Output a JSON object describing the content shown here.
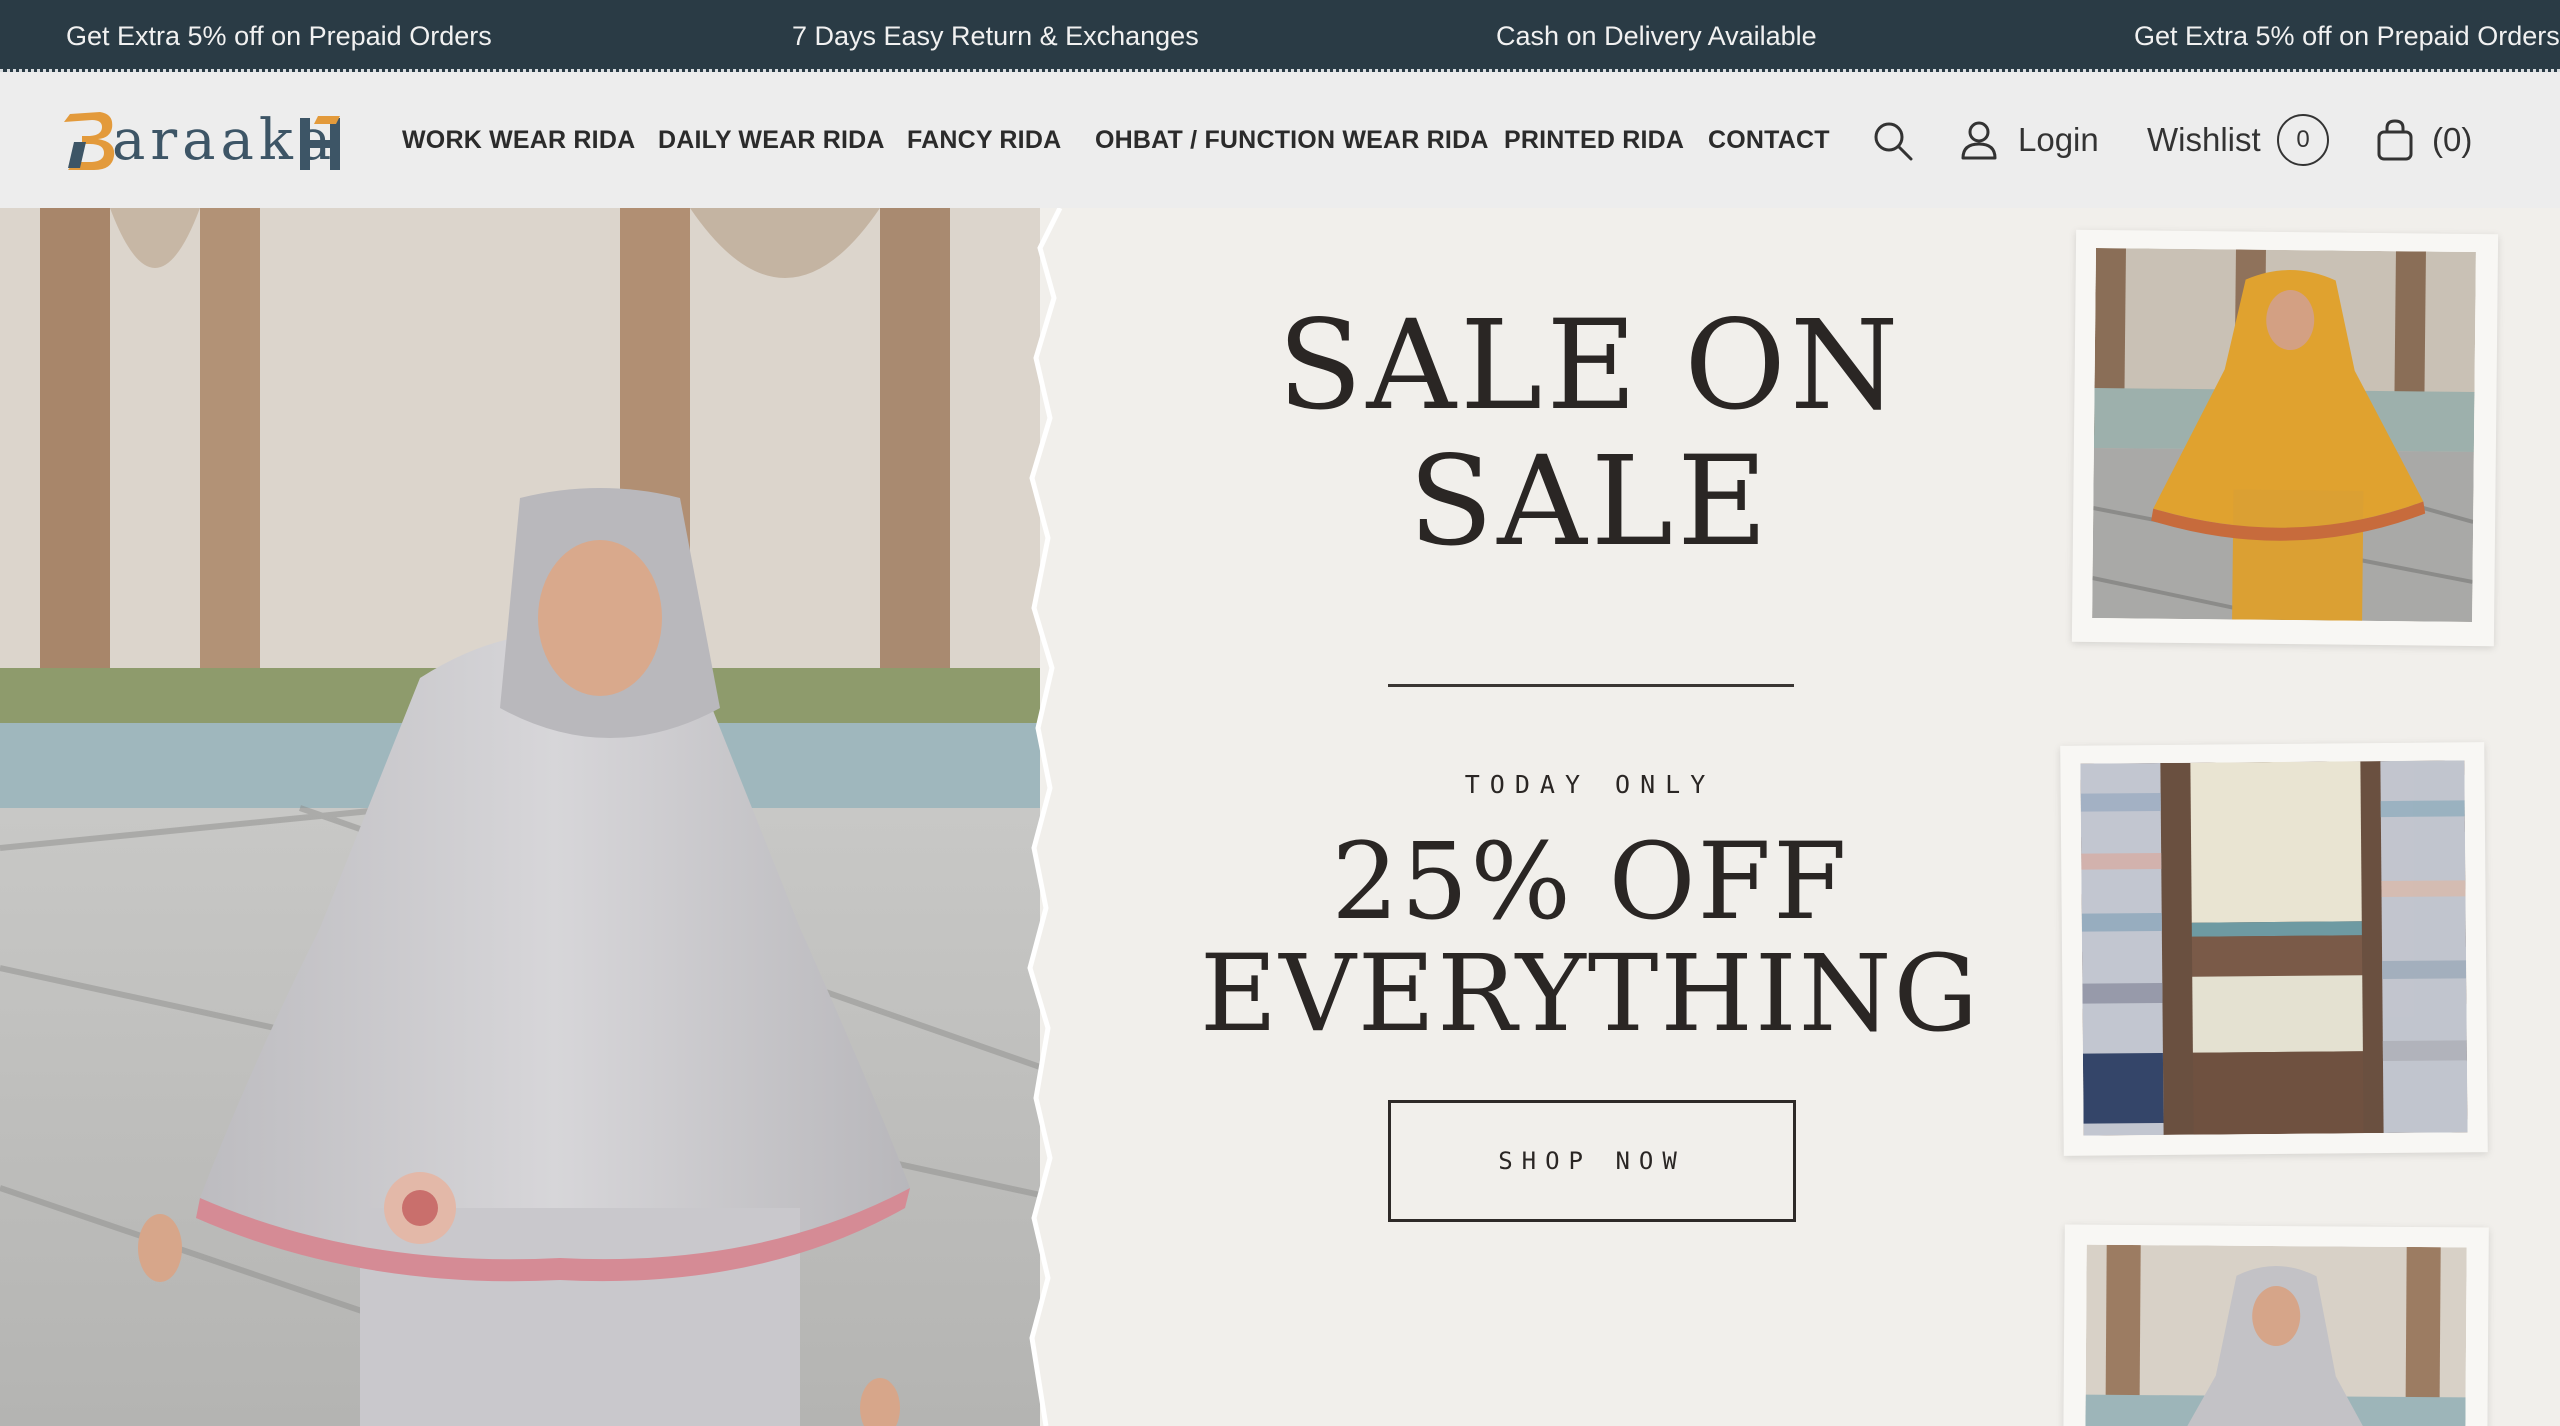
{
  "announcements": [
    "Get Extra 5% off on Prepaid Orders",
    "7 Days Easy Return & Exchanges",
    "Cash on Delivery Available",
    "Get Extra 5% off on Prepaid Orders"
  ],
  "logo": {
    "text": "araaka"
  },
  "nav": [
    "WORK WEAR RIDA",
    "DAILY WEAR RIDA",
    "FANCY RIDA",
    "OHBAT / FUNCTION WEAR RIDA",
    "PRINTED RIDA",
    "CONTACT"
  ],
  "header": {
    "login_label": "Login",
    "wishlist_label": "Wishlist",
    "wishlist_count": "0",
    "cart_count": "(0)"
  },
  "hero": {
    "title_line1": "SALE ON",
    "title_line2": "SALE",
    "kicker": "TODAY ONLY",
    "offer_line1": "25% OFF",
    "offer_line2": "EVERYTHING",
    "cta": "SHOP NOW"
  },
  "colors": {
    "announce_bg": "#2a3b45",
    "header_bg": "#ededed",
    "paper_bg": "#f1efeb",
    "logo_blue": "#3d5566",
    "logo_orange": "#e39a3b",
    "text_dark": "#2a2624"
  },
  "icons": [
    "search-icon",
    "user-icon",
    "bag-icon"
  ]
}
